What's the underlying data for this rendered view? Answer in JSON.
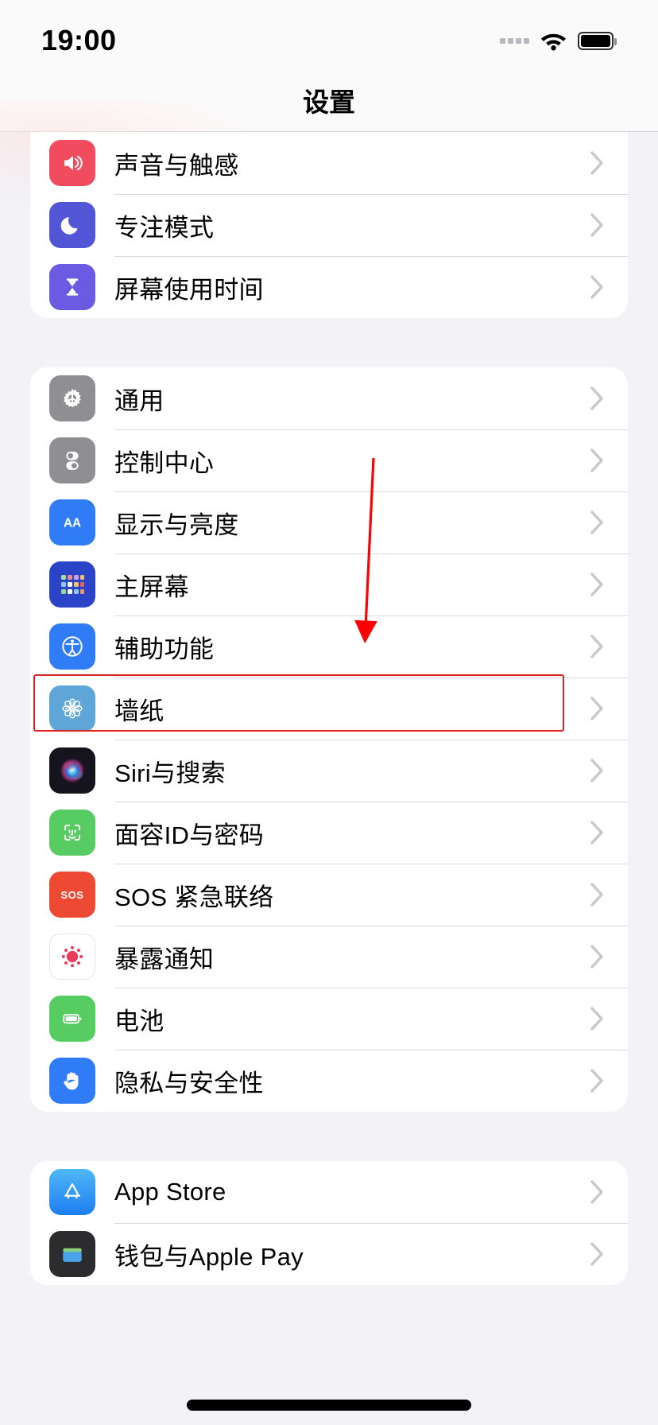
{
  "status_bar": {
    "time": "19:00",
    "signal_icon": "signal-dots-icon",
    "wifi_icon": "wifi-icon",
    "battery_icon": "battery-full-icon"
  },
  "nav": {
    "title": "设置"
  },
  "annotation": {
    "arrow_color": "#FF0000",
    "box_color": "#E02020",
    "target_row_label": "墙纸"
  },
  "groups": [
    {
      "id": "group-system-1",
      "rows": [
        {
          "label": "声音与触感",
          "icon": "sound-haptics-icon",
          "icon_bg": "#F04B5E",
          "chevron": "chevron-right-icon"
        },
        {
          "label": "专注模式",
          "icon": "focus-moon-icon",
          "icon_bg": "#5256D6",
          "chevron": "chevron-right-icon"
        },
        {
          "label": "屏幕使用时间",
          "icon": "screen-time-hourglass-icon",
          "icon_bg": "#6A5BE2",
          "chevron": "chevron-right-icon"
        }
      ]
    },
    {
      "id": "group-system-2",
      "rows": [
        {
          "label": "通用",
          "icon": "gear-icon",
          "icon_bg": "#8E8E93",
          "chevron": "chevron-right-icon"
        },
        {
          "label": "控制中心",
          "icon": "control-center-toggles-icon",
          "icon_bg": "#8E8E93",
          "chevron": "chevron-right-icon"
        },
        {
          "label": "显示与亮度",
          "icon": "display-brightness-aa-icon",
          "icon_bg": "#2F7CF6",
          "chevron": "chevron-right-icon"
        },
        {
          "label": "主屏幕",
          "icon": "home-screen-grid-icon",
          "icon_bg": "#2B44C7",
          "chevron": "chevron-right-icon"
        },
        {
          "label": "辅助功能",
          "icon": "accessibility-icon",
          "icon_bg": "#2F7CF6",
          "chevron": "chevron-right-icon"
        },
        {
          "label": "墙纸",
          "icon": "wallpaper-flower-icon",
          "icon_bg": "#5FA6D8",
          "chevron": "chevron-right-icon",
          "highlighted": true
        },
        {
          "label": "Siri与搜索",
          "icon": "siri-orb-icon",
          "icon_bg": "#1A1A24",
          "chevron": "chevron-right-icon"
        },
        {
          "label": "面容ID与密码",
          "icon": "face-id-icon",
          "icon_bg": "#56CC62",
          "chevron": "chevron-right-icon"
        },
        {
          "label": "SOS 紧急联络",
          "icon": "sos-icon",
          "icon_bg": "#EE4A33",
          "chevron": "chevron-right-icon"
        },
        {
          "label": "暴露通知",
          "icon": "exposure-notification-icon",
          "icon_bg": "#FFFFFF",
          "chevron": "chevron-right-icon"
        },
        {
          "label": "电池",
          "icon": "battery-icon",
          "icon_bg": "#56CC62",
          "chevron": "chevron-right-icon"
        },
        {
          "label": "隐私与安全性",
          "icon": "privacy-hand-icon",
          "icon_bg": "#2F7CF6",
          "chevron": "chevron-right-icon"
        }
      ]
    },
    {
      "id": "group-apps",
      "rows": [
        {
          "label": "App Store",
          "icon": "app-store-icon",
          "icon_bg": "#3BA3F2",
          "chevron": "chevron-right-icon"
        },
        {
          "label": "钱包与Apple Pay",
          "icon": "wallet-icon",
          "icon_bg": "#2C2C2E",
          "chevron": "chevron-right-icon",
          "clipped": true
        }
      ]
    }
  ]
}
